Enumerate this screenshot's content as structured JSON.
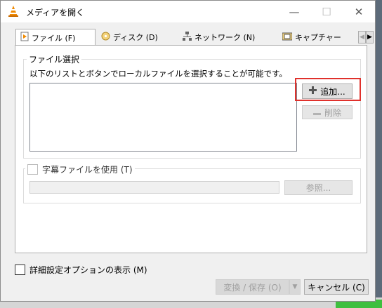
{
  "window": {
    "title": "メディアを開く",
    "controls": {
      "minimize": "—",
      "maximize": "☐",
      "close": "✕"
    }
  },
  "tabs": [
    {
      "label": "ファイル (F)",
      "icon": "file-icon"
    },
    {
      "label": "ディスク (D)",
      "icon": "disc-icon"
    },
    {
      "label": "ネットワーク (N)",
      "icon": "network-icon"
    },
    {
      "label": "キャプチャー",
      "icon": "capture-icon"
    }
  ],
  "file_selection": {
    "legend": "ファイル選択",
    "description": "以下のリストとボタンでローカルファイルを選択することが可能です。",
    "add_button": "追加...",
    "remove_button": "削除"
  },
  "subtitle": {
    "checkbox_label": "字幕ファイルを使用 (T)",
    "browse_button": "参照..."
  },
  "advanced_options": {
    "checkbox_label": "詳細設定オプションの表示 (M)"
  },
  "footer": {
    "convert_button": "変換 / 保存 (O)",
    "cancel_button": "キャンセル (C)"
  },
  "colors": {
    "highlight": "#e0312c",
    "vlc_orange": "#f08a00"
  }
}
